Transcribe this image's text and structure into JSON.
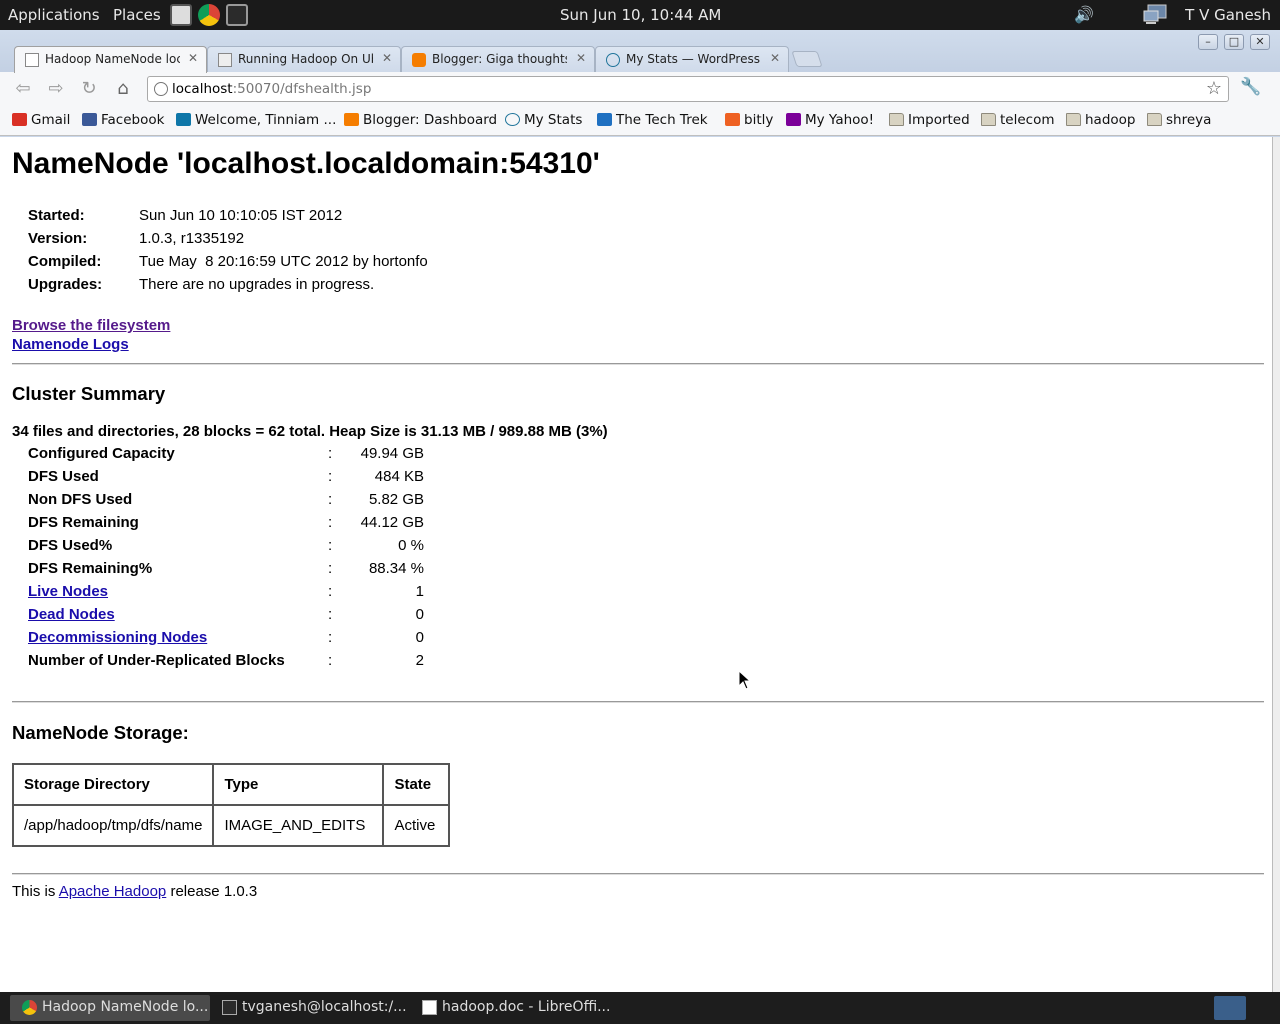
{
  "top_panel": {
    "applications": "Applications",
    "places": "Places",
    "clock": "Sun Jun 10, 10:44 AM",
    "user": "T V Ganesh"
  },
  "browser": {
    "tabs": [
      {
        "title": "Hadoop NameNode localhost",
        "favicon": "page-icon",
        "active": true
      },
      {
        "title": "Running Hadoop On Ubuntu",
        "favicon": "page-icon",
        "active": false
      },
      {
        "title": "Blogger: Giga thoughts...",
        "favicon": "blogger-icon",
        "active": false
      },
      {
        "title": "My Stats — WordPress.com",
        "favicon": "wordpress-icon",
        "active": false
      }
    ],
    "url_host": "localhost",
    "url_path": ":50070/dfshealth.jsp",
    "bookmarks": [
      {
        "label": "Gmail",
        "icon": "gmail-icon",
        "color": "#d93025"
      },
      {
        "label": "Facebook",
        "icon": "facebook-icon",
        "color": "#3b5998"
      },
      {
        "label": "Welcome, Tinniam ...",
        "icon": "linkedin-icon",
        "color": "#0e76a8"
      },
      {
        "label": "Blogger: Dashboard",
        "icon": "blogger-icon",
        "color": "#f57d00"
      },
      {
        "label": "My Stats",
        "icon": "wordpress-icon",
        "color": "#21759b"
      },
      {
        "label": "The Tech Trek",
        "icon": "ibm-icon",
        "color": "#1f70c1"
      },
      {
        "label": "bitly",
        "icon": "bitly-icon",
        "color": "#ee6123"
      },
      {
        "label": "My Yahoo!",
        "icon": "yahoo-icon",
        "color": "#7b0099"
      },
      {
        "label": "Imported",
        "icon": "folder-icon",
        "color": "#d8d3c2"
      },
      {
        "label": "telecom",
        "icon": "folder-icon",
        "color": "#d8d3c2"
      },
      {
        "label": "hadoop",
        "icon": "folder-icon",
        "color": "#d8d3c2"
      },
      {
        "label": "shreya",
        "icon": "folder-icon",
        "color": "#d8d3c2"
      }
    ]
  },
  "page": {
    "title": "NameNode 'localhost.localdomain:54310'",
    "info": [
      {
        "key": "Started:",
        "value": "Sun Jun 10 10:10:05 IST 2012"
      },
      {
        "key": "Version:",
        "value": "1.0.3, r1335192"
      },
      {
        "key": "Compiled:",
        "value": "Tue May  8 20:16:59 UTC 2012 by hortonfo"
      },
      {
        "key": "Upgrades:",
        "value": "There are no upgrades in progress."
      }
    ],
    "links": {
      "browse": "Browse the filesystem",
      "logs": "Namenode Logs"
    },
    "cluster_summary": {
      "heading": "Cluster Summary",
      "summary_line": "34 files and directories, 28 blocks = 62 total. Heap Size is 31.13 MB / 989.88 MB (3%)",
      "rows": [
        {
          "label": "Configured Capacity",
          "value": "49.94 GB",
          "link": false
        },
        {
          "label": "DFS Used",
          "value": "484 KB",
          "link": false
        },
        {
          "label": "Non DFS Used",
          "value": "5.82 GB",
          "link": false
        },
        {
          "label": "DFS Remaining",
          "value": "44.12 GB",
          "link": false
        },
        {
          "label": "DFS Used%",
          "value": "0 %",
          "link": false
        },
        {
          "label": "DFS Remaining%",
          "value": "88.34 %",
          "link": false
        },
        {
          "label": "Live Nodes",
          "value": "1",
          "link": true
        },
        {
          "label": "Dead Nodes",
          "value": "0",
          "link": true
        },
        {
          "label": "Decommissioning Nodes",
          "value": "0",
          "link": true
        },
        {
          "label": "Number of Under-Replicated Blocks",
          "value": "2",
          "link": false
        }
      ],
      "separator": ":"
    },
    "storage": {
      "heading": "NameNode Storage:",
      "headers": [
        "Storage Directory",
        "Type",
        "State"
      ],
      "rows": [
        [
          "/app/hadoop/tmp/dfs/name",
          "IMAGE_AND_EDITS",
          "Active"
        ]
      ]
    },
    "footer": {
      "prefix": "This is ",
      "link": "Apache Hadoop",
      "suffix": " release 1.0.3"
    }
  },
  "taskbar": {
    "tasks": [
      {
        "label": "Hadoop NameNode lo...",
        "icon": "chrome-icon",
        "active": true
      },
      {
        "label": "tvganesh@localhost:/...",
        "icon": "terminal-icon",
        "active": false
      },
      {
        "label": "hadoop.doc - LibreOffi...",
        "icon": "document-icon",
        "active": false
      }
    ]
  }
}
